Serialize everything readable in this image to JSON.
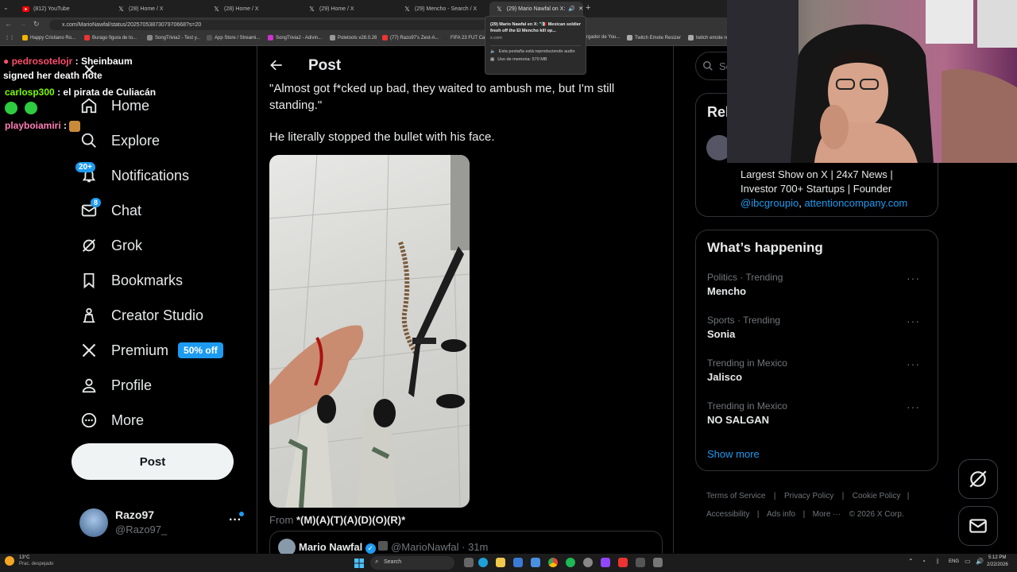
{
  "browser": {
    "tabs": [
      {
        "label": "(812) YouTube",
        "icon": "youtube-icon",
        "active": false
      },
      {
        "label": "(28) Home / X",
        "icon": "x-icon",
        "active": false
      },
      {
        "label": "(28) Home / X",
        "icon": "x-icon",
        "active": false
      },
      {
        "label": "(29) Home / X",
        "icon": "x-icon",
        "active": false
      },
      {
        "label": "(29) Mencho - Search / X",
        "icon": "x-icon",
        "active": false
      },
      {
        "label": "(29) Mario Nawfal on X: \"🇲🇽...",
        "icon": "x-icon",
        "active": true
      }
    ],
    "url": "x.com/MarioNawfal/status/2025705387307970668?s=20",
    "bookmarks": [
      "Happy Cristiano Ro...",
      "Burago figura de to...",
      "SongTrivia2 - Test y...",
      "App Store / Streami...",
      "SongTrivia2 - Adivin...",
      "Poletools v28.0.28",
      "(77) Razo97's Zest-A...",
      "FIFA 23 FUT Ca...",
      "rgador de You...",
      "Twitch Emote Resizer",
      "twitch emote re..."
    ],
    "tooltip": {
      "title": "(29) Mario Nawfal en X: \"🇲🇽 Mexican soldier fresh off the El Mencho kill op...",
      "domain": "x.com",
      "audio": "Esta pestaña está reproduciendo audio",
      "memory": "Uso de memoria: 570 MB"
    }
  },
  "chat_overlay": [
    {
      "user": "pedrosotelojr",
      "msg": ": Sheinbaum signed her death note",
      "color": "#ff4d6d"
    },
    {
      "user": "carlosp300",
      "msg": ": el pirata de Culiacán",
      "color": "#7cfc00"
    },
    {
      "user": "playboiamiri",
      "msg": ":",
      "color": "#ff7eb6"
    }
  ],
  "nav": {
    "home": "Home",
    "explore": "Explore",
    "notifications": "Notifications",
    "notifications_badge": "20+",
    "chat": "Chat",
    "chat_badge": "8",
    "grok": "Grok",
    "bookmarks": "Bookmarks",
    "creator_studio": "Creator Studio",
    "premium": "Premium",
    "premium_offer": "50% off",
    "profile": "Profile",
    "more": "More",
    "post_button": "Post"
  },
  "account": {
    "name": "Razo97",
    "handle": "@Razo97_",
    "more": "···"
  },
  "post": {
    "header": "Post",
    "text1": "\"Almost got f*cked up bad, they waited to ambush me, but I'm still standing.\"",
    "text2": "He literally stopped the bullet with his face.",
    "from_label": "From",
    "from_user": "*(M)(A)(T)(A)(D)(O)(R)*",
    "quoted_name": "Mario Nawfal",
    "quoted_handle": "@MarioNawfal",
    "quoted_time": "· 31m"
  },
  "sidebar": {
    "search_placeholder": "Se",
    "relevant_title": "Rel",
    "relevant_bio": "Largest Show on X | 24x7 News | Investor 700+ Startups | Founder",
    "relevant_link1": "@ibcgroupio",
    "relevant_sep": ",",
    "relevant_link2": "attentioncompany.com",
    "happening_title": "What’s happening",
    "trends": [
      {
        "meta": "Politics · Trending",
        "name": "Mencho"
      },
      {
        "meta": "Sports · Trending",
        "name": "Sonia"
      },
      {
        "meta": "Trending in Mexico",
        "name": "Jalisco"
      },
      {
        "meta": "Trending in Mexico",
        "name": "NO SALGAN"
      }
    ],
    "trend_more": "···",
    "show_more": "Show more",
    "footer": [
      "Terms of Service",
      "Privacy Policy",
      "Cookie Policy",
      "Accessibility",
      "Ads info",
      "More ···",
      "© 2026 X Corp."
    ],
    "footer_sep": "|"
  },
  "taskbar": {
    "weather_temp": "13°C",
    "weather_desc": "Prac. despejado",
    "search": "Search",
    "lang": "ENG",
    "time": "5:12 PM",
    "date": "2/22/2026"
  },
  "colors": {
    "accent": "#1d9bf0",
    "text_primary": "#e7e9ea",
    "text_secondary": "#71767b",
    "border": "#2f3336"
  }
}
